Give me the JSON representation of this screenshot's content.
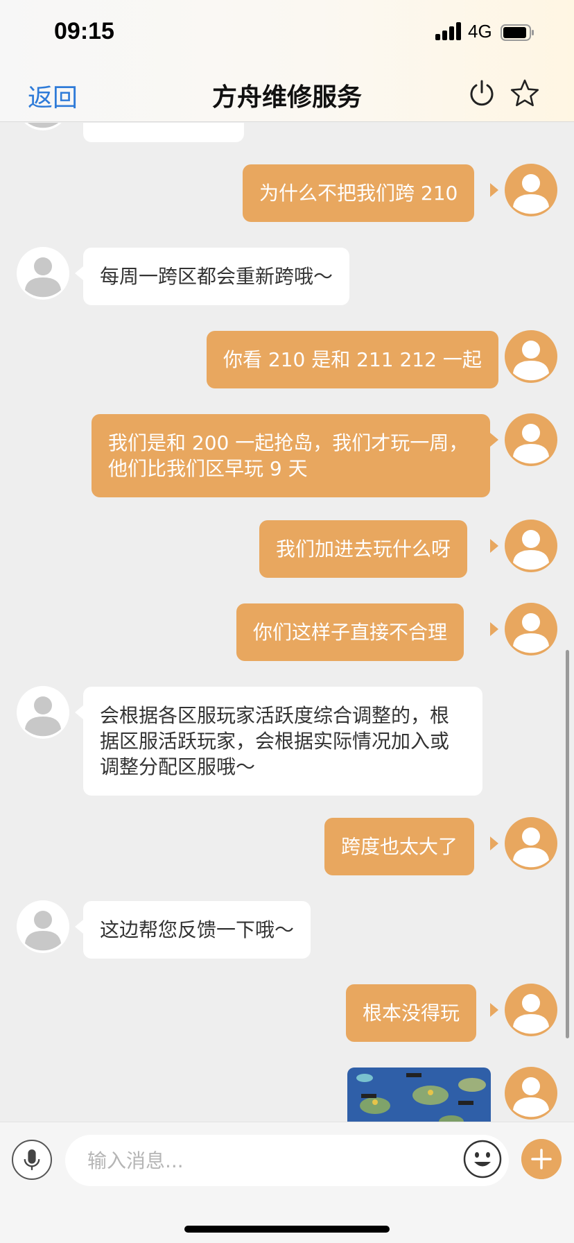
{
  "status_bar": {
    "time": "09:15",
    "network": "4G"
  },
  "nav": {
    "back_label": "返回",
    "title": "方舟维修服务",
    "power_icon": "power-icon",
    "star_icon": "star-icon"
  },
  "messages": [
    {
      "side": "in",
      "text": ""
    },
    {
      "side": "out",
      "text": "为什么不把我们跨 210"
    },
    {
      "side": "in",
      "text": "每周一跨区都会重新跨哦～"
    },
    {
      "side": "out",
      "text": "你看 210 是和 211 212 一起"
    },
    {
      "side": "out",
      "text": "我们是和 200 一起抢岛，我们才玩一周，他们比我们区早玩 9 天"
    },
    {
      "side": "out",
      "text": "我们加进去玩什么呀"
    },
    {
      "side": "out",
      "text": "你们这样子直接不合理"
    },
    {
      "side": "in",
      "text": "会根据各区服玩家活跃度综合调整的，根据区服活跃玩家，会根据实际情况加入或调整分配区服哦～"
    },
    {
      "side": "out",
      "text": "跨度也太大了"
    },
    {
      "side": "in",
      "text": "这边帮您反馈一下哦～"
    },
    {
      "side": "out",
      "text": "根本没得玩"
    },
    {
      "side": "out",
      "type": "image",
      "text": ""
    }
  ],
  "input_bar": {
    "placeholder": "输入消息...",
    "mic_icon": "microphone-icon",
    "emoji_icon": "emoji-icon",
    "plus_icon": "plus-icon"
  },
  "colors": {
    "outgoing_bubble": "#e8a75f",
    "incoming_bubble": "#ffffff",
    "background": "#eeeeee",
    "link": "#2f7bd8"
  }
}
